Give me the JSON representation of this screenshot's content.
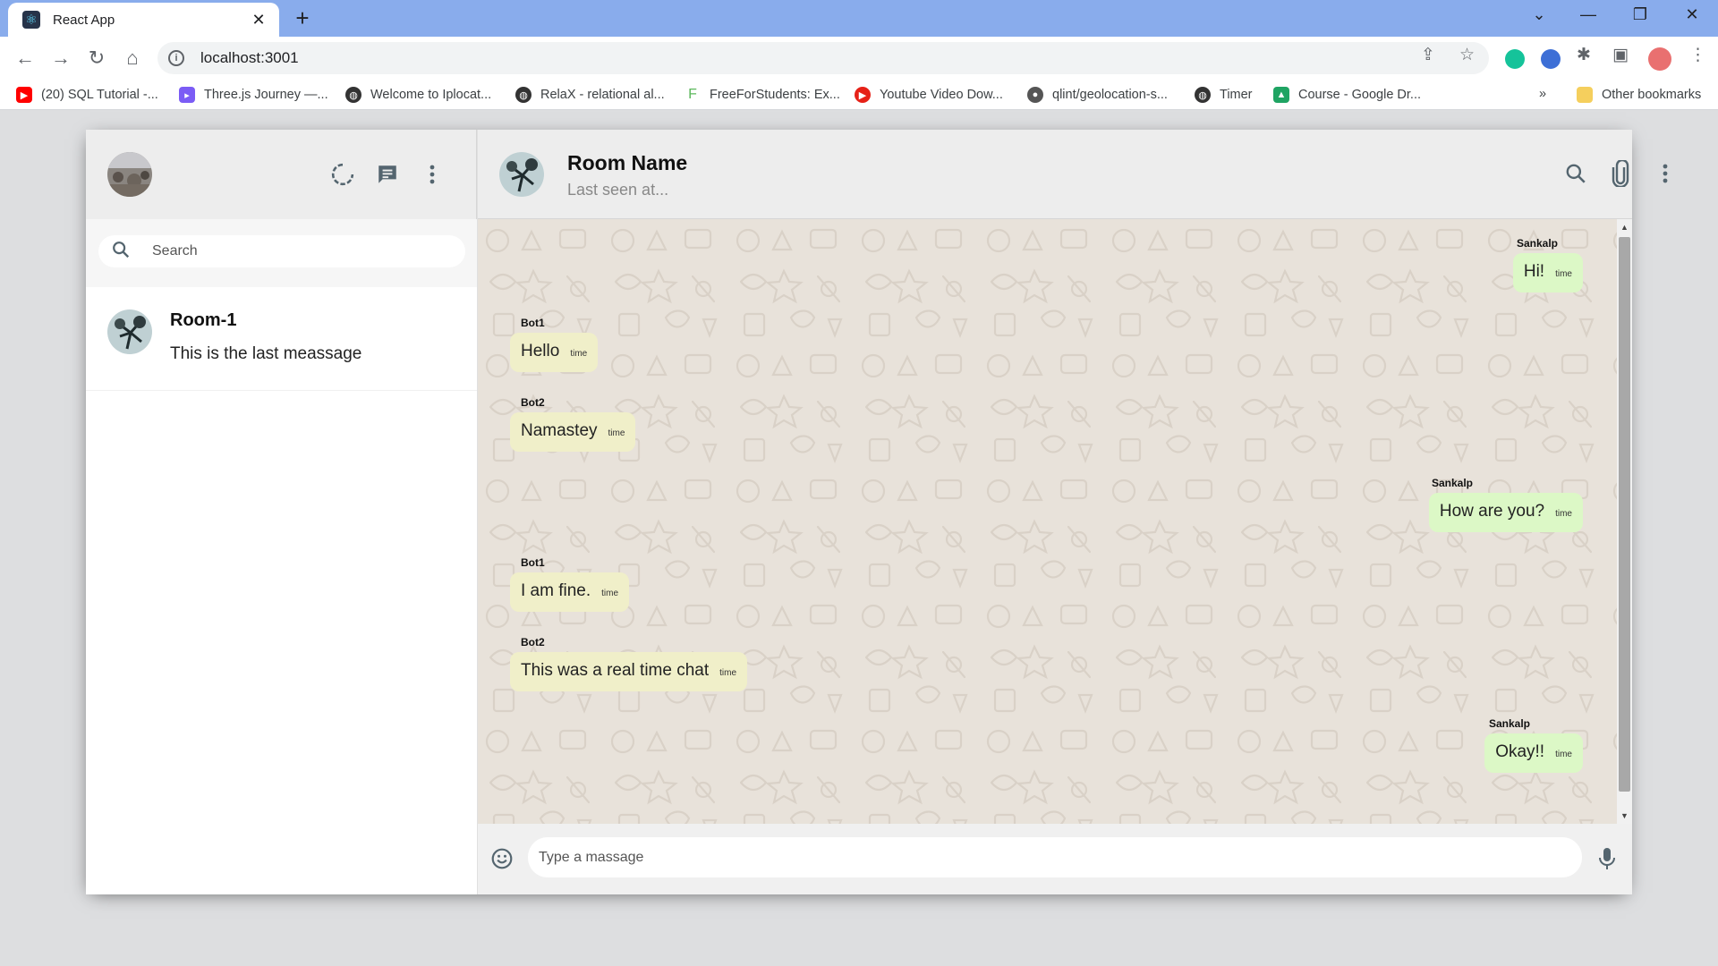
{
  "browser": {
    "tab_title": "React App",
    "url": "localhost:3001",
    "bookmarks": [
      {
        "label": "(20) SQL Tutorial -...",
        "color": "#ff0000"
      },
      {
        "label": "Three.js Journey —...",
        "color": "#7b5cf5"
      },
      {
        "label": "Welcome to Iplocat...",
        "color": "#333333"
      },
      {
        "label": "RelaX - relational al...",
        "color": "#333333"
      },
      {
        "label": "FreeForStudents: Ex...",
        "color": "#5cb85c"
      },
      {
        "label": "Youtube Video Dow...",
        "color": "#e62117"
      },
      {
        "label": "qlint/geolocation-s...",
        "color": "#555555"
      },
      {
        "label": "Timer",
        "color": "#333333"
      },
      {
        "label": "Course - Google Dr...",
        "color": "#1fa463"
      }
    ],
    "other_bookmarks": "Other bookmarks"
  },
  "sidebar": {
    "search_placeholder": "Search",
    "rooms": [
      {
        "name": "Room-1",
        "last_message": "This is the last meassage"
      }
    ]
  },
  "chat": {
    "room_name": "Room Name",
    "last_seen": "Last seen at...",
    "messages": [
      {
        "sender": "Sankalp",
        "text": "Hi!",
        "time": "time",
        "sent": true
      },
      {
        "sender": "Bot1",
        "text": "Hello",
        "time": "time",
        "sent": false
      },
      {
        "sender": "Bot2",
        "text": "Namastey",
        "time": "time",
        "sent": false
      },
      {
        "sender": "Sankalp",
        "text": "How are you?",
        "time": "time",
        "sent": true
      },
      {
        "sender": "Bot1",
        "text": "I am fine.",
        "time": "time",
        "sent": false
      },
      {
        "sender": "Bot2",
        "text": "This was a real time chat",
        "time": "time",
        "sent": false
      },
      {
        "sender": "Sankalp",
        "text": "Okay!!",
        "time": "time",
        "sent": true
      }
    ],
    "input_placeholder": "Type a massage"
  },
  "colors": {
    "received_bubble": "#f0efc9",
    "sent_bubble": "#dcf8c6",
    "chat_background": "#e8e2da",
    "header_background": "#ededed"
  }
}
